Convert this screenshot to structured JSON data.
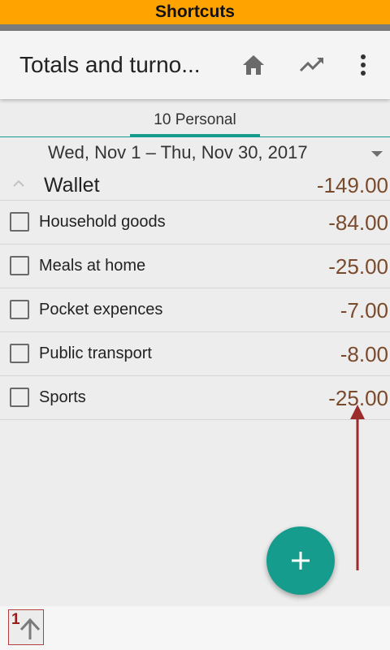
{
  "shortcuts": {
    "title": "Shortcuts"
  },
  "app_bar": {
    "title": "Totals and turno...",
    "actions": [
      {
        "icon": "home-icon"
      },
      {
        "icon": "trending-up-icon"
      },
      {
        "icon": "more-vert-icon"
      }
    ]
  },
  "tab": {
    "label": "10 Personal"
  },
  "date_range": {
    "label": "Wed, Nov 1 – Thu, Nov 30, 2017"
  },
  "group": {
    "name": "Wallet",
    "total": "-149.00",
    "items": [
      {
        "name": "Household goods",
        "amount": "-84.00",
        "checked": false
      },
      {
        "name": "Meals at home",
        "amount": "-25.00",
        "checked": false
      },
      {
        "name": "Pocket expences",
        "amount": "-7.00",
        "checked": false
      },
      {
        "name": "Public transport",
        "amount": "-8.00",
        "checked": false
      },
      {
        "name": "Sports",
        "amount": "-25.00",
        "checked": false
      }
    ]
  },
  "bottom_bar": {
    "shortcut_number": "1",
    "shortcut_icon": "arrow-up-icon"
  },
  "colors": {
    "banner": "#ffa300",
    "accent": "#169c8c",
    "amount": "#7a4a2d",
    "annotation": "#9c2b2b"
  }
}
